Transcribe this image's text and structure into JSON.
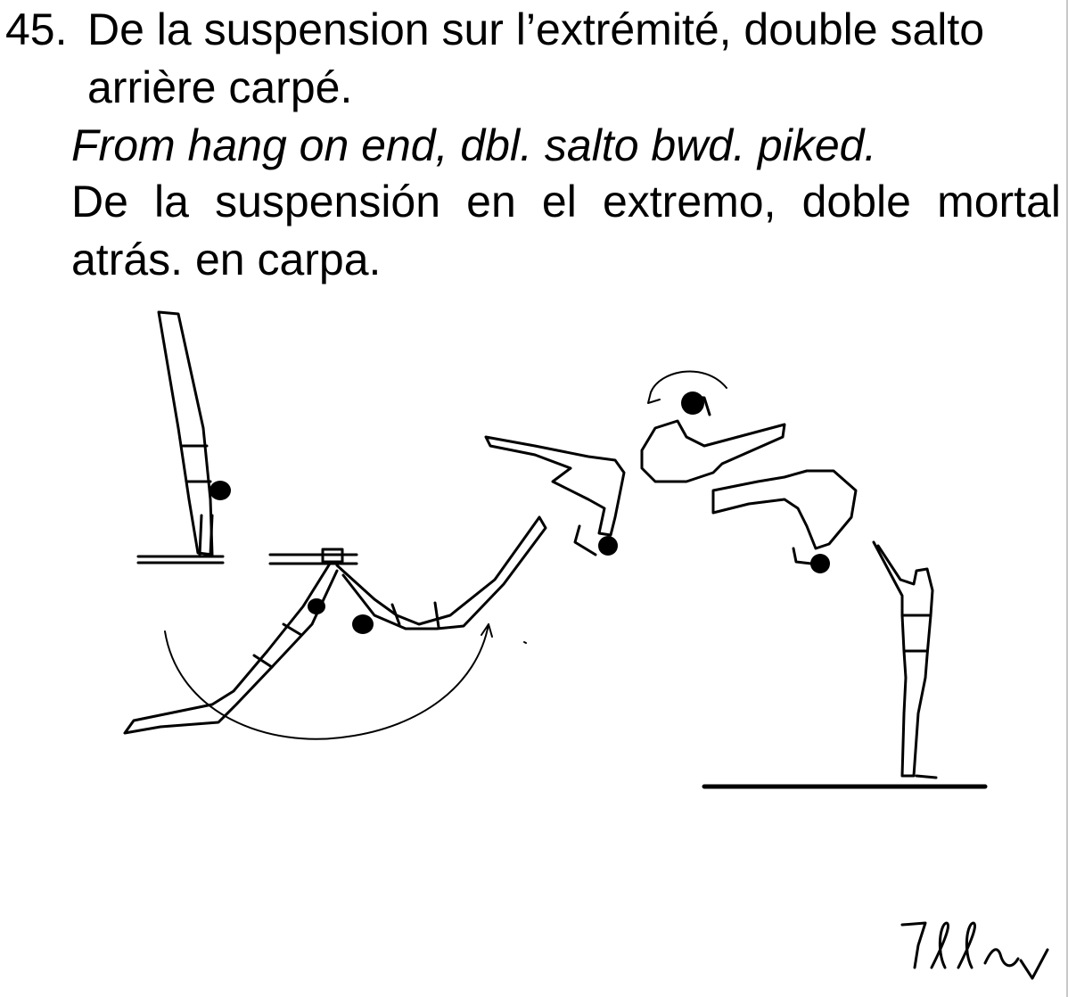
{
  "element": {
    "number": "45.",
    "title_fr_line1": "De la suspension sur l’extrémité, double salto",
    "title_fr_line2": "arrière carpé.",
    "title_en": "From hang on end, dbl. salto bwd. piked.",
    "title_es_line1": "De la suspensión en el extremo, doble mortal",
    "title_es_line2": "atrás. en carpa."
  },
  "illustration": {
    "description_icon": "gymnast-double-salto-sequence-icon",
    "ink_color": "#000000"
  },
  "signature": {
    "text": "Tller",
    "icon": "handwritten-signature-icon"
  }
}
